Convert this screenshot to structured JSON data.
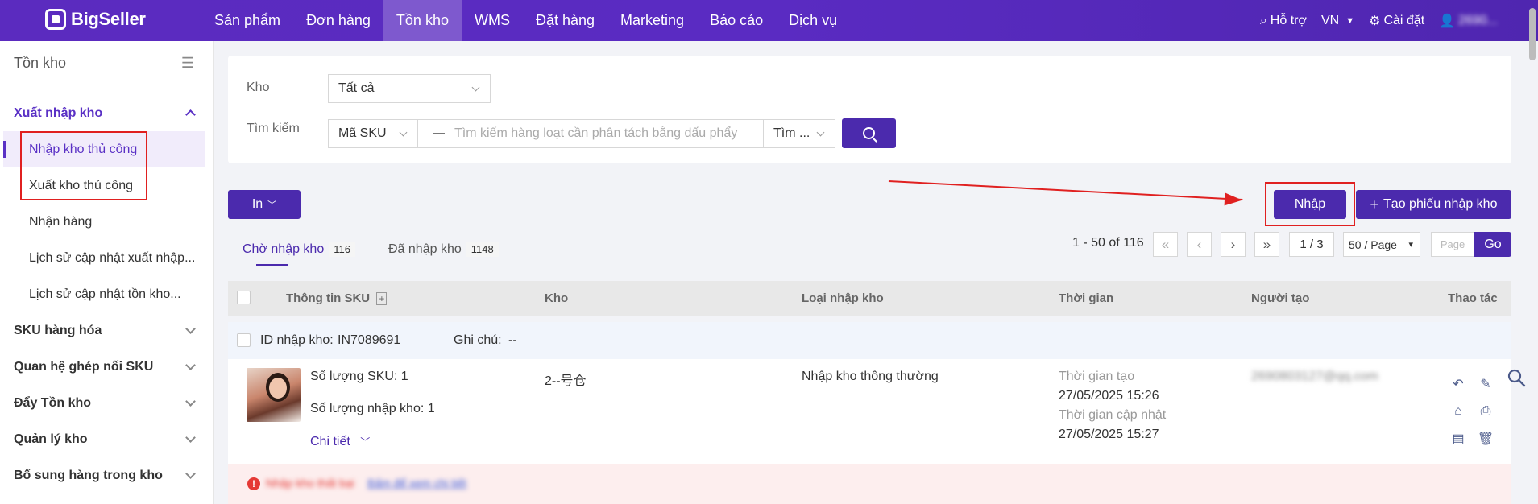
{
  "app": {
    "logo_text": "BigSeller"
  },
  "nav": {
    "items": [
      {
        "label": "Sản phẩm"
      },
      {
        "label": "Đơn hàng"
      },
      {
        "label": "Tồn kho",
        "active": true
      },
      {
        "label": "WMS"
      },
      {
        "label": "Đặt hàng"
      },
      {
        "label": "Marketing"
      },
      {
        "label": "Báo cáo"
      },
      {
        "label": "Dịch vụ"
      }
    ],
    "support": "Hỗ trợ",
    "lang": "VN",
    "settings": "Cài đặt",
    "user": "2690..."
  },
  "sidebar": {
    "title": "Tồn kho",
    "group_open": "Xuất nhập kho",
    "items": [
      {
        "label": "Nhập kho thủ công",
        "active": true
      },
      {
        "label": "Xuất kho thủ công"
      },
      {
        "label": "Nhận hàng"
      },
      {
        "label": "Lịch sử cập nhật xuất nhập..."
      },
      {
        "label": "Lịch sử cập nhật tồn kho..."
      }
    ],
    "groups": [
      {
        "label": "SKU hàng hóa"
      },
      {
        "label": "Quan hệ ghép nối SKU"
      },
      {
        "label": "Đẩy Tồn kho"
      },
      {
        "label": "Quản lý kho"
      },
      {
        "label": "Bổ sung hàng trong kho"
      }
    ]
  },
  "filter": {
    "warehouse_label": "Kho",
    "warehouse_value": "Tất cả",
    "search_label": "Tìm kiếm",
    "search_type": "Mã SKU",
    "search_placeholder": "Tìm kiếm hàng loạt cần phân tách bằng dấu phẩy",
    "search_mode": "Tìm ..."
  },
  "actions": {
    "print": "In",
    "import": "Nhập",
    "create": "Tạo phiếu nhập kho"
  },
  "tabs": [
    {
      "label": "Chờ nhập kho",
      "count": "116"
    },
    {
      "label": "Đã nhập kho",
      "count": "1148"
    }
  ],
  "pagination": {
    "range": "1 - 50 of 116",
    "page": "1 / 3",
    "per_page": "50 / Page",
    "page_placeholder": "Page",
    "go": "Go"
  },
  "table": {
    "columns": [
      "Thông tin SKU",
      "Kho",
      "Loại nhập kho",
      "Thời gian",
      "Người tạo",
      "Thao tác"
    ],
    "record": {
      "id_label": "ID nhập kho:",
      "id": "IN7089691",
      "note_label": "Ghi chú:",
      "note": "--",
      "sku_count": "Số lượng SKU: 1",
      "import_qty": "Số lượng nhập kho: 1",
      "detail": "Chi tiết",
      "warehouse": "2--号仓",
      "type": "Nhập kho thông thường",
      "created_label": "Thời gian tạo",
      "created": "27/05/2025 15:26",
      "updated_label": "Thời gian cập nhật",
      "updated": "27/05/2025 15:27",
      "creator": "2690803127@qq.com"
    },
    "error": {
      "text": "Nhập kho thất bại",
      "link": "Bấm để xem chi tiết"
    }
  }
}
